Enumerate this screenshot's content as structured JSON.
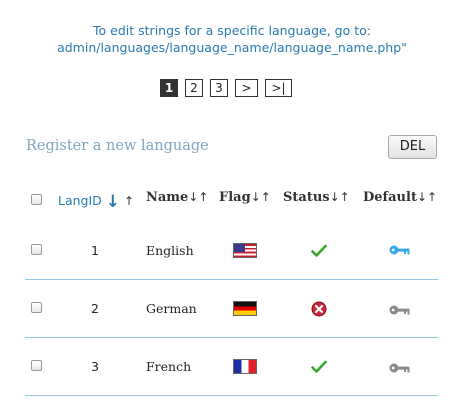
{
  "notice": {
    "line1": "To edit strings for a specific language, go to:",
    "line2": "admin/languages/language_name/language_name.php\""
  },
  "pagination": {
    "pages": [
      "1",
      "2",
      "3"
    ],
    "current": "1",
    "next_label": ">",
    "last_label": ">|"
  },
  "register_link": "Register a new language",
  "del_button": "DEL",
  "columns": {
    "langid": "LangID",
    "langid_sort_down": "↓",
    "langid_sort_up": "↑",
    "name": "Name",
    "flag": "Flag",
    "status": "Status",
    "default": "Default",
    "sort_arrows": "↓↑"
  },
  "rows": [
    {
      "id": "1",
      "name": "English",
      "flag": "us-flag-icon",
      "status": "active",
      "default": true
    },
    {
      "id": "2",
      "name": "German",
      "flag": "german-flag-icon",
      "status": "inactive",
      "default": false
    },
    {
      "id": "3",
      "name": "French",
      "flag": "french-flag-icon",
      "status": "active",
      "default": false
    }
  ],
  "colors": {
    "link": "#2a7ab0",
    "register": "#7ea6c0",
    "separator": "#9cc7e0",
    "check": "#3aa52b",
    "error": "#c8283a",
    "default_key": "#3aa8e8",
    "key_inactive": "#8a8a8a"
  }
}
